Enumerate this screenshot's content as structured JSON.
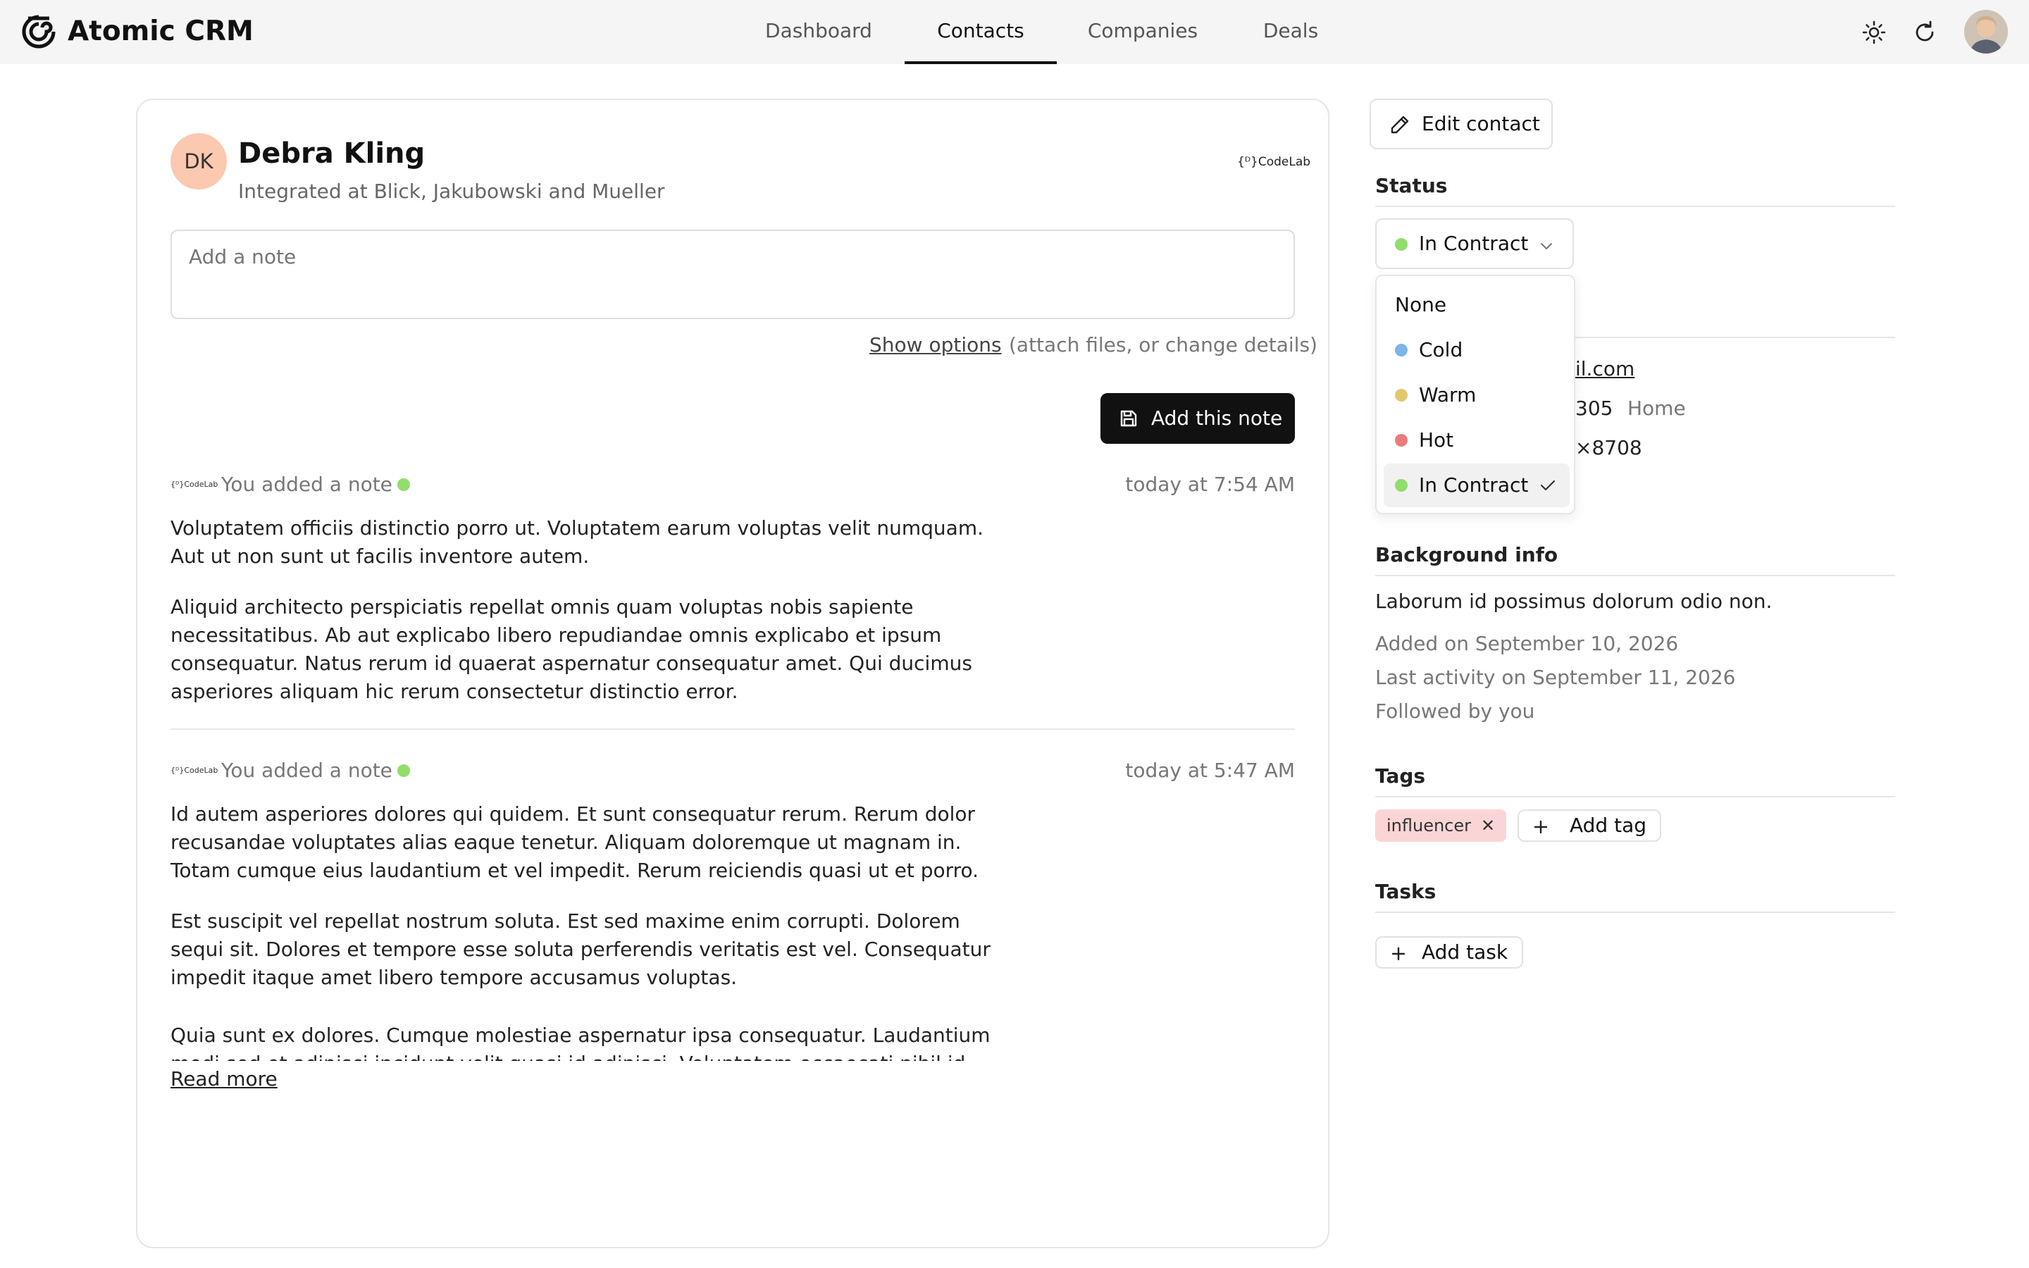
{
  "app": {
    "title": "Atomic CRM"
  },
  "nav": {
    "tabs": [
      {
        "label": "Dashboard"
      },
      {
        "label": "Contacts"
      },
      {
        "label": "Companies"
      },
      {
        "label": "Deals"
      }
    ],
    "active": "Contacts"
  },
  "header_icons": [
    "sun-icon",
    "refresh-icon",
    "user-avatar"
  ],
  "contact": {
    "initials": "DK",
    "name": "Debra Kling",
    "subtitle": "Integrated at Blick, Jakubowski and Mueller",
    "company_logo_text": "{ᴰ}CodeLab"
  },
  "note_form": {
    "placeholder": "Add a note",
    "show_options": "Show options",
    "show_options_hint": "(attach files, or change details)",
    "submit_label": "Add this note"
  },
  "notes": [
    {
      "author": "You added a note",
      "time": "today at 7:54 AM",
      "paragraphs": [
        "Voluptatem officiis distinctio porro ut. Voluptatem earum voluptas velit numquam. Aut ut non sunt ut facilis inventore autem.",
        "Aliquid architecto perspiciatis repellat omnis quam voluptas nobis sapiente necessitatibus. Ab aut explicabo libero repudiandae omnis explicabo et ipsum consequatur. Natus rerum id quaerat aspernatur consequatur amet. Qui ducimus asperiores aliquam hic rerum consectetur distinctio error."
      ]
    },
    {
      "author": "You added a note",
      "time": "today at 5:47 AM",
      "paragraphs": [
        "Id autem asperiores dolores qui quidem. Et sunt consequatur rerum. Rerum dolor recusandae voluptates alias eaque tenetur. Aliquam doloremque ut magnam in. Totam cumque eius laudantium et vel impedit. Rerum reiciendis quasi ut et porro.",
        "Est suscipit vel repellat nostrum soluta. Est sed maxime enim corrupti. Dolorem sequi sit. Dolores et tempore esse soluta perferendis veritatis est vel. Consequatur impedit itaque amet libero tempore accusamus voluptas.",
        "Quia sunt ex dolores. Cumque molestiae aspernatur ipsa consequatur. Laudantium modi sed et adipisci incidunt velit quasi id adipisci. Voluptatem occaecati nihil id maiores nisi."
      ],
      "read_more": "Read more"
    }
  ],
  "sidebar": {
    "edit_label": "Edit contact",
    "status_title": "Status",
    "status_value": "In Contract",
    "status_options": [
      {
        "label": "None",
        "color": ""
      },
      {
        "label": "Cold",
        "color": "#7cb5e8"
      },
      {
        "label": "Warm",
        "color": "#e3c770"
      },
      {
        "label": "Hot",
        "color": "#e87c7c"
      },
      {
        "label": "In Contract",
        "color": "#90de6b"
      }
    ],
    "email_partial": "il.com",
    "phone1_partial": "305",
    "phone1_type": "Home",
    "phone2_partial": "×8708",
    "background_title": "Background info",
    "background_text": "Laborum id possimus dolorum odio non.",
    "added_on": "Added on September 10, 2026",
    "last_activity": "Last activity on September 11, 2026",
    "followed": "Followed by you",
    "tags_title": "Tags",
    "tags": [
      {
        "label": "influencer"
      }
    ],
    "add_tag_label": "Add tag",
    "tasks_title": "Tasks",
    "add_task_label": "Add task"
  }
}
